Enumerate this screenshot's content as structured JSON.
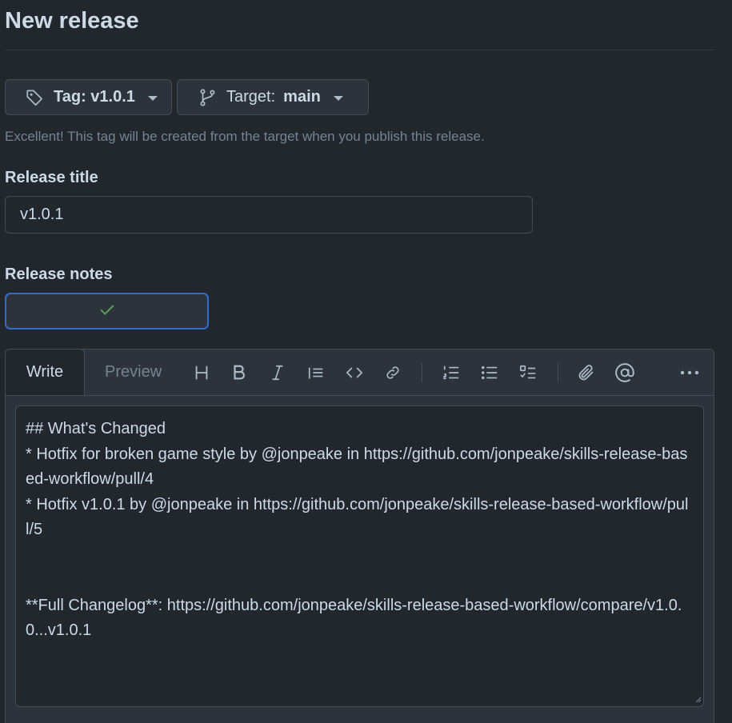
{
  "page": {
    "title": "New release"
  },
  "tag_button": {
    "label": "Tag: v1.0.1",
    "icon": "tag-icon"
  },
  "target_button": {
    "label": "Target:",
    "value": "main",
    "icon": "git-branch-icon"
  },
  "hint": "Excellent! This tag will be created from the target when you publish this release.",
  "release_title": {
    "label": "Release title",
    "value": "v1.0.1"
  },
  "release_notes": {
    "label": "Release notes",
    "status_icon": "check-icon"
  },
  "editor": {
    "tabs": {
      "write": "Write",
      "preview": "Preview"
    },
    "toolbar": [
      "heading-icon",
      "bold-icon",
      "italic-icon",
      "quote-icon",
      "code-icon",
      "link-icon",
      "ordered-list-icon",
      "unordered-list-icon",
      "task-list-icon",
      "attach-icon",
      "mention-icon",
      "more-icon"
    ],
    "content": "## What's Changed\n* Hotfix for broken game style by @jonpeake in https://github.com/jonpeake/skills-release-based-workflow/pull/4\n* Hotfix v1.0.1 by @jonpeake in https://github.com/jonpeake/skills-release-based-workflow/pull/5\n\n\n**Full Changelog**: https://github.com/jonpeake/skills-release-based-workflow/compare/v1.0.0...v1.0.1"
  },
  "colors": {
    "background": "#22272e",
    "accent_border": "#316dca",
    "success": "#57ab5a"
  }
}
